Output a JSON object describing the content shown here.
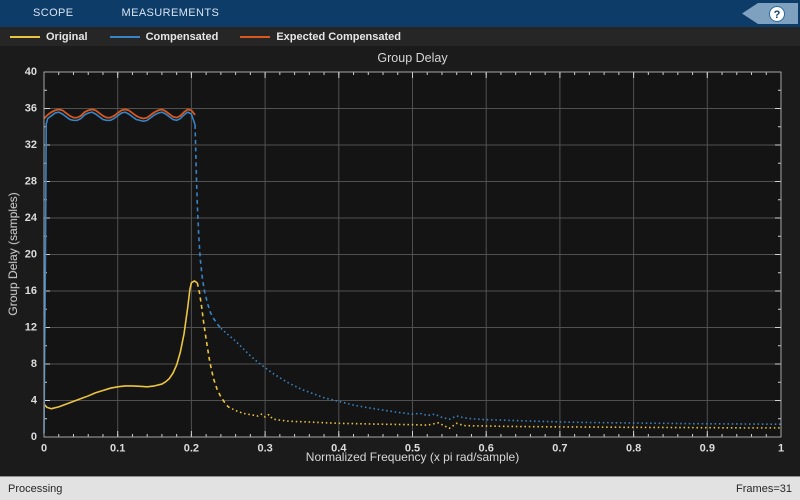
{
  "toolbar": {
    "tabs": [
      {
        "label": "SCOPE"
      },
      {
        "label": "MEASUREMENTS"
      }
    ],
    "help_glyph": "?"
  },
  "legend": {
    "items": [
      {
        "label": "Original",
        "color": "#ecc540"
      },
      {
        "label": "Compensated",
        "color": "#3884c6"
      },
      {
        "label": "Expected Compensated",
        "color": "#d9581e"
      }
    ]
  },
  "status_bar": {
    "left": "Processing",
    "right": "Frames=31"
  },
  "chart_data": {
    "type": "line",
    "title": "Group Delay",
    "xlabel": "Normalized Frequency (x pi rad/sample)",
    "ylabel": "Group Delay (samples)",
    "xlim": [
      0,
      1
    ],
    "ylim": [
      0,
      40
    ],
    "grid": true,
    "legend_position": "top",
    "plot_bg": "#141414",
    "grid_color": "#505050",
    "box_color": "#a6a6a6",
    "tick_color": "#d0d0d0",
    "tick_label_color": "#dcdcdc",
    "xticks": {
      "values": [
        0,
        0.1,
        0.2,
        0.3,
        0.4,
        0.5,
        0.6,
        0.7,
        0.8,
        0.9,
        1
      ],
      "labels": [
        "0",
        "0.1",
        "0.2",
        "0.3",
        "0.4",
        "0.5",
        "0.6",
        "0.7",
        "0.8",
        "0.9",
        "1"
      ]
    },
    "yticks": {
      "values": [
        0,
        4,
        8,
        12,
        16,
        20,
        24,
        28,
        32,
        36,
        40
      ],
      "labels": [
        "0",
        "4",
        "8",
        "12",
        "16",
        "20",
        "24",
        "28",
        "32",
        "36",
        "40"
      ]
    },
    "minor_x_step": 0.02,
    "minor_y_step": 2,
    "series": [
      {
        "name": "Original",
        "color": "#ecc540",
        "width": 1.6,
        "segments": [
          {
            "style": "solid",
            "points": [
              [
                0,
                3.6
              ],
              [
                0.004,
                3.25
              ],
              [
                0.01,
                3.1
              ],
              [
                0.02,
                3.3
              ],
              [
                0.03,
                3.6
              ],
              [
                0.04,
                3.9
              ],
              [
                0.05,
                4.2
              ],
              [
                0.06,
                4.5
              ],
              [
                0.07,
                4.85
              ],
              [
                0.08,
                5.1
              ],
              [
                0.09,
                5.35
              ],
              [
                0.1,
                5.5
              ],
              [
                0.11,
                5.6
              ],
              [
                0.12,
                5.6
              ],
              [
                0.13,
                5.55
              ],
              [
                0.14,
                5.5
              ],
              [
                0.15,
                5.6
              ],
              [
                0.16,
                5.8
              ],
              [
                0.165,
                6.05
              ],
              [
                0.17,
                6.4
              ],
              [
                0.175,
                7.0
              ],
              [
                0.18,
                7.9
              ],
              [
                0.185,
                9.3
              ],
              [
                0.19,
                11.3
              ],
              [
                0.195,
                14.2
              ],
              [
                0.198,
                16.2
              ],
              [
                0.2,
                16.9
              ],
              [
                0.204,
                17.1
              ],
              [
                0.208,
                16.9
              ]
            ]
          },
          {
            "style": "dashed",
            "points": [
              [
                0.208,
                16.9
              ],
              [
                0.211,
                15.8
              ],
              [
                0.214,
                14.2
              ],
              [
                0.217,
                12.3
              ],
              [
                0.221,
                10.2
              ],
              [
                0.225,
                8.2
              ],
              [
                0.23,
                6.4
              ],
              [
                0.235,
                5.2
              ],
              [
                0.24,
                4.4
              ],
              [
                0.245,
                3.8
              ],
              [
                0.25,
                3.3
              ]
            ]
          },
          {
            "style": "dotted",
            "points": [
              [
                0.25,
                3.3
              ],
              [
                0.26,
                2.9
              ],
              [
                0.27,
                2.6
              ],
              [
                0.28,
                2.45
              ],
              [
                0.29,
                2.3
              ],
              [
                0.295,
                2.5
              ],
              [
                0.3,
                2.2
              ],
              [
                0.305,
                2.45
              ],
              [
                0.31,
                2.0
              ],
              [
                0.315,
                1.9
              ],
              [
                0.32,
                1.85
              ],
              [
                0.33,
                1.75
              ],
              [
                0.34,
                1.7
              ],
              [
                0.35,
                1.68
              ],
              [
                0.37,
                1.6
              ],
              [
                0.4,
                1.5
              ],
              [
                0.43,
                1.45
              ],
              [
                0.46,
                1.4
              ],
              [
                0.5,
                1.35
              ],
              [
                0.52,
                1.3
              ],
              [
                0.535,
                1.55
              ],
              [
                0.55,
                0.95
              ],
              [
                0.56,
                1.5
              ],
              [
                0.57,
                1.25
              ],
              [
                0.6,
                1.2
              ],
              [
                0.64,
                1.15
              ],
              [
                0.68,
                1.12
              ],
              [
                0.72,
                1.1
              ],
              [
                0.76,
                1.08
              ],
              [
                0.8,
                1.06
              ],
              [
                0.85,
                1.04
              ],
              [
                0.9,
                1.02
              ],
              [
                0.95,
                1.0
              ],
              [
                1.0,
                1.0
              ]
            ]
          }
        ]
      },
      {
        "name": "Compensated",
        "color": "#3884c6",
        "width": 1.6,
        "segments": [
          {
            "style": "solid",
            "points": [
              [
                0,
                0.4
              ],
              [
                0.002,
                20
              ],
              [
                0.003,
                34.3
              ],
              [
                0.005,
                34.9
              ],
              [
                0.01,
                35.2
              ],
              [
                0.015,
                35.5
              ],
              [
                0.02,
                35.6
              ],
              [
                0.025,
                35.4
              ],
              [
                0.03,
                35.1
              ],
              [
                0.035,
                34.8
              ],
              [
                0.04,
                34.7
              ],
              [
                0.045,
                34.7
              ],
              [
                0.05,
                34.9
              ],
              [
                0.055,
                35.3
              ],
              [
                0.06,
                35.5
              ],
              [
                0.065,
                35.6
              ],
              [
                0.07,
                35.4
              ],
              [
                0.075,
                35.1
              ],
              [
                0.08,
                34.8
              ],
              [
                0.085,
                34.7
              ],
              [
                0.09,
                34.7
              ],
              [
                0.095,
                34.9
              ],
              [
                0.1,
                35.2
              ],
              [
                0.105,
                35.5
              ],
              [
                0.11,
                35.6
              ],
              [
                0.115,
                35.4
              ],
              [
                0.12,
                35.1
              ],
              [
                0.125,
                34.8
              ],
              [
                0.13,
                34.7
              ],
              [
                0.135,
                34.6
              ],
              [
                0.14,
                34.7
              ],
              [
                0.145,
                35.0
              ],
              [
                0.15,
                35.3
              ],
              [
                0.155,
                35.5
              ],
              [
                0.16,
                35.6
              ],
              [
                0.165,
                35.4
              ],
              [
                0.17,
                35.1
              ],
              [
                0.175,
                34.8
              ],
              [
                0.18,
                34.7
              ],
              [
                0.185,
                34.9
              ],
              [
                0.19,
                35.3
              ],
              [
                0.195,
                35.6
              ],
              [
                0.2,
                35.4
              ],
              [
                0.205,
                34.2
              ]
            ]
          },
          {
            "style": "dashed",
            "points": [
              [
                0.205,
                34.2
              ],
              [
                0.206,
                31
              ],
              [
                0.207,
                28
              ],
              [
                0.208,
                25.5
              ],
              [
                0.21,
                22
              ],
              [
                0.212,
                19.5
              ],
              [
                0.215,
                17.3
              ],
              [
                0.218,
                15.9
              ],
              [
                0.222,
                14.6
              ],
              [
                0.226,
                13.6
              ],
              [
                0.23,
                13.0
              ],
              [
                0.235,
                12.4
              ],
              [
                0.24,
                11.9
              ]
            ]
          },
          {
            "style": "dotted",
            "points": [
              [
                0.24,
                11.9
              ],
              [
                0.25,
                11.2
              ],
              [
                0.26,
                10.5
              ],
              [
                0.27,
                9.7
              ],
              [
                0.28,
                8.9
              ],
              [
                0.29,
                8.2
              ],
              [
                0.3,
                7.6
              ],
              [
                0.31,
                7.0
              ],
              [
                0.32,
                6.5
              ],
              [
                0.33,
                6.0
              ],
              [
                0.34,
                5.6
              ],
              [
                0.35,
                5.2
              ],
              [
                0.36,
                4.9
              ],
              [
                0.37,
                4.6
              ],
              [
                0.38,
                4.3
              ],
              [
                0.39,
                4.1
              ],
              [
                0.4,
                3.9
              ],
              [
                0.42,
                3.5
              ],
              [
                0.44,
                3.2
              ],
              [
                0.46,
                2.95
              ],
              [
                0.48,
                2.7
              ],
              [
                0.5,
                2.5
              ],
              [
                0.51,
                2.6
              ],
              [
                0.52,
                2.35
              ],
              [
                0.53,
                2.5
              ],
              [
                0.54,
                2.15
              ],
              [
                0.55,
                1.95
              ],
              [
                0.56,
                2.3
              ],
              [
                0.57,
                2.1
              ],
              [
                0.58,
                2.0
              ],
              [
                0.6,
                1.9
              ],
              [
                0.62,
                1.85
              ],
              [
                0.64,
                1.8
              ],
              [
                0.66,
                1.75
              ],
              [
                0.68,
                1.7
              ],
              [
                0.7,
                1.65
              ],
              [
                0.73,
                1.6
              ],
              [
                0.76,
                1.57
              ],
              [
                0.8,
                1.53
              ],
              [
                0.84,
                1.5
              ],
              [
                0.88,
                1.46
              ],
              [
                0.92,
                1.44
              ],
              [
                0.96,
                1.42
              ],
              [
                1.0,
                1.4
              ]
            ]
          }
        ]
      },
      {
        "name": "Expected Compensated",
        "color": "#d9581e",
        "width": 1.8,
        "segments": [
          {
            "style": "solid",
            "points": [
              [
                0,
                34.9
              ],
              [
                0.005,
                35.3
              ],
              [
                0.01,
                35.6
              ],
              [
                0.015,
                35.8
              ],
              [
                0.02,
                35.9
              ],
              [
                0.025,
                35.8
              ],
              [
                0.03,
                35.5
              ],
              [
                0.035,
                35.2
              ],
              [
                0.04,
                35.0
              ],
              [
                0.045,
                35.0
              ],
              [
                0.05,
                35.2
              ],
              [
                0.055,
                35.6
              ],
              [
                0.06,
                35.8
              ],
              [
                0.065,
                35.9
              ],
              [
                0.07,
                35.8
              ],
              [
                0.075,
                35.5
              ],
              [
                0.08,
                35.2
              ],
              [
                0.085,
                35.0
              ],
              [
                0.09,
                35.0
              ],
              [
                0.095,
                35.2
              ],
              [
                0.1,
                35.5
              ],
              [
                0.105,
                35.8
              ],
              [
                0.11,
                35.9
              ],
              [
                0.115,
                35.8
              ],
              [
                0.12,
                35.5
              ],
              [
                0.125,
                35.2
              ],
              [
                0.13,
                35.0
              ],
              [
                0.135,
                34.9
              ],
              [
                0.14,
                35.0
              ],
              [
                0.145,
                35.3
              ],
              [
                0.15,
                35.6
              ],
              [
                0.155,
                35.8
              ],
              [
                0.16,
                35.9
              ],
              [
                0.165,
                35.7
              ],
              [
                0.17,
                35.4
              ],
              [
                0.175,
                35.1
              ],
              [
                0.18,
                35.0
              ],
              [
                0.185,
                35.2
              ],
              [
                0.19,
                35.6
              ],
              [
                0.195,
                35.9
              ],
              [
                0.2,
                35.8
              ],
              [
                0.205,
                35.3
              ]
            ]
          }
        ]
      }
    ]
  }
}
